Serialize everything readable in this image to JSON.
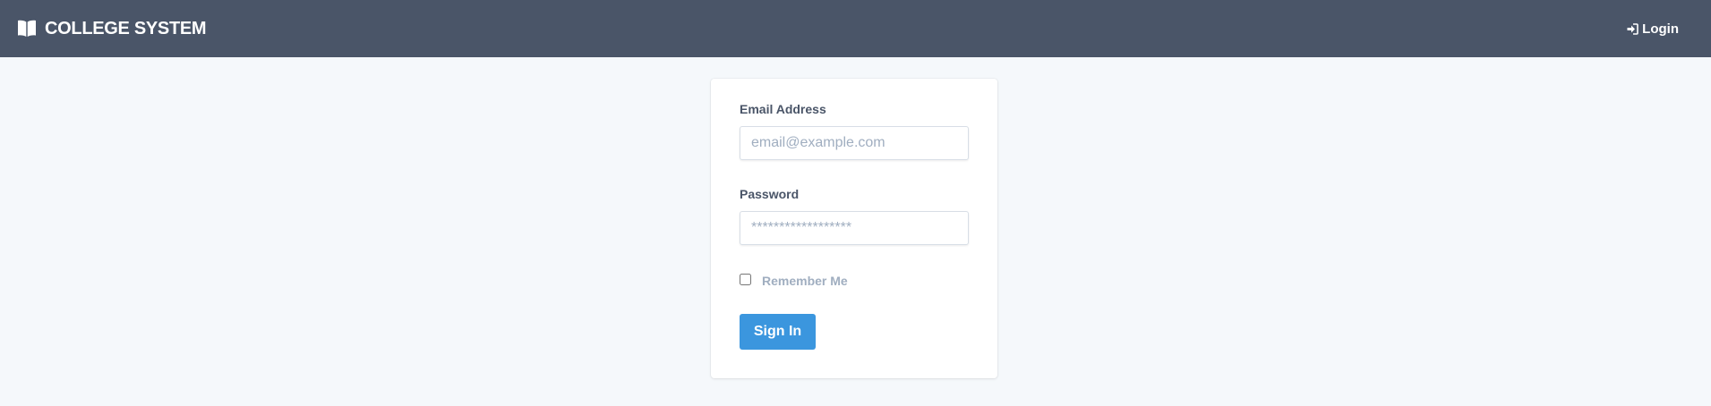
{
  "navbar": {
    "brand_icon": "book-open-icon",
    "brand_title": "COLLEGE SYSTEM",
    "login_icon": "sign-in-icon",
    "login_label": "Login",
    "background": "#4a5568"
  },
  "form": {
    "email_label": "Email Address",
    "email_placeholder": "email@example.com",
    "email_value": "",
    "password_label": "Password",
    "password_placeholder": "******************",
    "password_value": "",
    "remember_label": "Remember Me",
    "remember_checked": false,
    "submit_label": "Sign In",
    "submit_color": "#3b96de"
  }
}
